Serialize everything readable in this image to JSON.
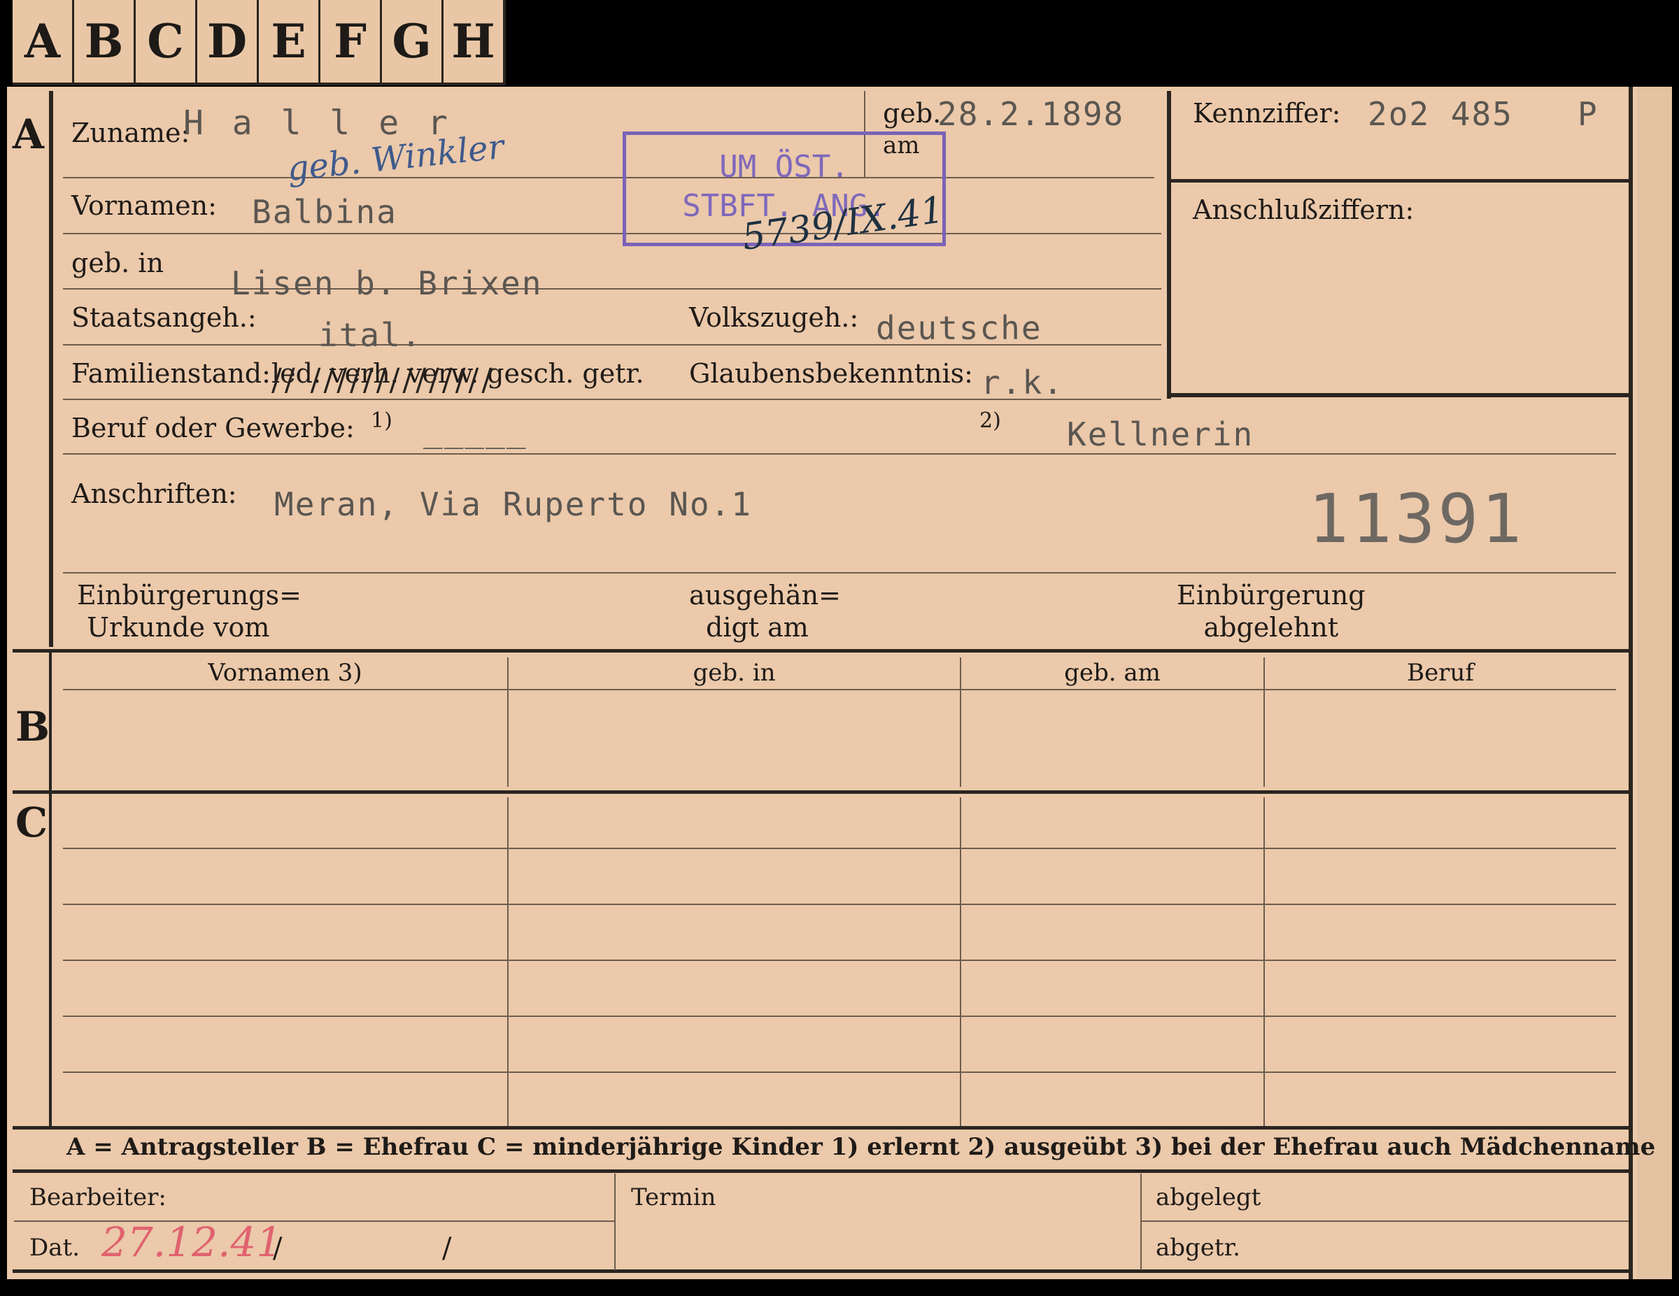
{
  "tabs": [
    "A",
    "B",
    "C",
    "D",
    "E",
    "F",
    "G",
    "H"
  ],
  "sections": {
    "a": "A",
    "b": "B",
    "c": "C"
  },
  "fields": {
    "surname_label": "Zuname:",
    "surname_value": "H a l l e r",
    "surname_note": "geb. Winkler",
    "birthdate_label_1": "geb.",
    "birthdate_label_2": "am",
    "birthdate_value": "28.2.1898",
    "firstnames_label": "Vornamen:",
    "firstnames_value": "Balbina",
    "birthplace_label": "geb. in",
    "birthplace_value": "Lisen b. Brixen",
    "citizenship_label": "Staatsangeh.:",
    "citizenship_value": "ital.",
    "ethnicity_label": "Volkszugeh.:",
    "ethnicity_value": "deutsche",
    "marital_label": "Familienstand:",
    "marital_options": "led. verh. verw. gesch. getr.",
    "marital_strike": "// //////////////",
    "religion_label": "Glaubensbekenntnis:",
    "religion_value": "r.k.",
    "profession_label": "Beruf oder Gewerbe:",
    "profession_mark_1": "1)",
    "profession_learned": "_____",
    "profession_mark_2": "2)",
    "profession_practiced": "Kellnerin",
    "address_label": "Anschriften:",
    "address_value": "Meran, Via Ruperto No.1",
    "file_number": "11391",
    "ref_label": "Kennziffer:",
    "ref_value": "2o2 485",
    "ref_suffix": "P",
    "linked_label": "Anschlußziffern:",
    "naturalization_label_1": "Einbürgerungs=",
    "naturalization_label_2": "Urkunde vom",
    "issued_label_1": "ausgehän=",
    "issued_label_2": "digt am",
    "rejected_label_1": "Einbürgerung",
    "rejected_label_2": "abgelehnt"
  },
  "stamp": {
    "line1": "UM ÖST.",
    "line2": "STBFT. ANG.",
    "handwritten": "5739/IX.41"
  },
  "table_headers": [
    "Vornamen 3)",
    "geb. in",
    "geb. am",
    "Beruf"
  ],
  "legend": "A = Antragsteller   B = Ehefrau   C = minderjährige Kinder   1) erlernt   2) ausgeübt   3) bei der Ehefrau auch Mädchenname",
  "footer": {
    "processor_label": "Bearbeiter:",
    "date_label": "Dat.",
    "date_value": "27.12.41",
    "date_slash_1": "/",
    "date_slash_2": "/",
    "deadline_label": "Termin",
    "filed_label": "abgelegt",
    "dispatched_label": "abgetr."
  },
  "colors": {
    "card": "#ebc9aa",
    "ink": "#2a2520",
    "stamp": "#7a63b8",
    "pencil_red": "#e0626f",
    "typewriter": "#5a5651"
  }
}
